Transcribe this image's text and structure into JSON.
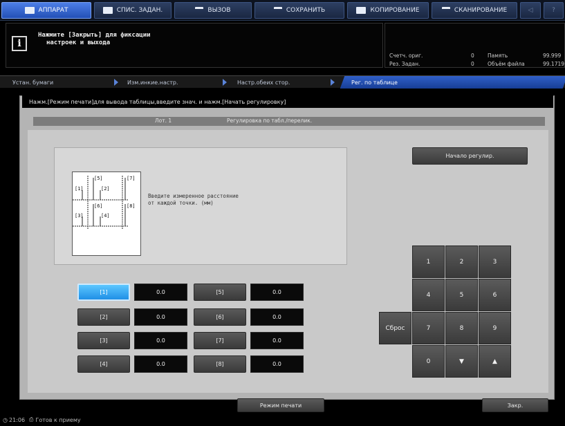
{
  "tabs": [
    {
      "label": "АППАРАТ",
      "icon": "machine-icon",
      "active": true
    },
    {
      "label": "СПИС. ЗАДАН.",
      "icon": "job-list-icon",
      "active": false
    },
    {
      "label": "ВЫЗОВ",
      "icon": "recall-icon",
      "active": false
    },
    {
      "label": "СОХРАНИТЬ",
      "icon": "save-icon",
      "active": false
    },
    {
      "label": "КОПИРОВАНИЕ",
      "icon": "copy-icon",
      "active": false
    },
    {
      "label": "СКАНИРОВАНИЕ",
      "icon": "scan-icon",
      "active": false
    }
  ],
  "top_icons": {
    "back": "◁",
    "help": "?"
  },
  "message": {
    "icon": "i",
    "line1": "Нажмите [Закрыть] для фиксации",
    "line2": "настроек и выхода"
  },
  "counters": {
    "orig_label": "Счетч. ориг.",
    "orig_value": "0",
    "mem_label": "Память",
    "mem_value": "99.999",
    "res_label": "Рез. Задан.",
    "res_value": "0",
    "file_label": "Объём файла",
    "file_value": "99.1719"
  },
  "breadcrumb": [
    "Устан. бумаги",
    "Изм.инкие.настр.",
    "Настр.обеих стор.",
    "Рег. по таблице"
  ],
  "instruction": "Нажм.[Режим печати]для вывода таблицы,введите знач. и нажм.[Начать регулировку]",
  "header": {
    "tray": "Лот. 1",
    "title": "Регулировка по табл./перелик."
  },
  "start_button": "Начало регулир.",
  "diagram": {
    "labels": [
      "[1]",
      "[2]",
      "[3]",
      "[4]",
      "[5]",
      "[6]",
      "[7]",
      "[8]"
    ],
    "text_line1": "Введите измеренное расстояние",
    "text_line2": "от каждой точки. (мм)"
  },
  "fields": [
    {
      "label": "[1]",
      "value": "0.0",
      "selected": true
    },
    {
      "label": "[2]",
      "value": "0.0",
      "selected": false
    },
    {
      "label": "[3]",
      "value": "0.0",
      "selected": false
    },
    {
      "label": "[4]",
      "value": "0.0",
      "selected": false
    },
    {
      "label": "[5]",
      "value": "0.0",
      "selected": false
    },
    {
      "label": "[6]",
      "value": "0.0",
      "selected": false
    },
    {
      "label": "[7]",
      "value": "0.0",
      "selected": false
    },
    {
      "label": "[8]",
      "value": "0.0",
      "selected": false
    }
  ],
  "keypad": {
    "keys": [
      "1",
      "2",
      "3",
      "4",
      "5",
      "6",
      "7",
      "8",
      "9",
      "0",
      "▼",
      "▲"
    ],
    "reset": "Сброс"
  },
  "print_mode_button": "Режим печати",
  "close_button": "Закр.",
  "status": {
    "time": "21:06",
    "text": "Готов к приему"
  },
  "colors": {
    "active_tab": "#2f63d0",
    "selected_field": "#2a9cf0",
    "panel": "#c9c9c9"
  }
}
